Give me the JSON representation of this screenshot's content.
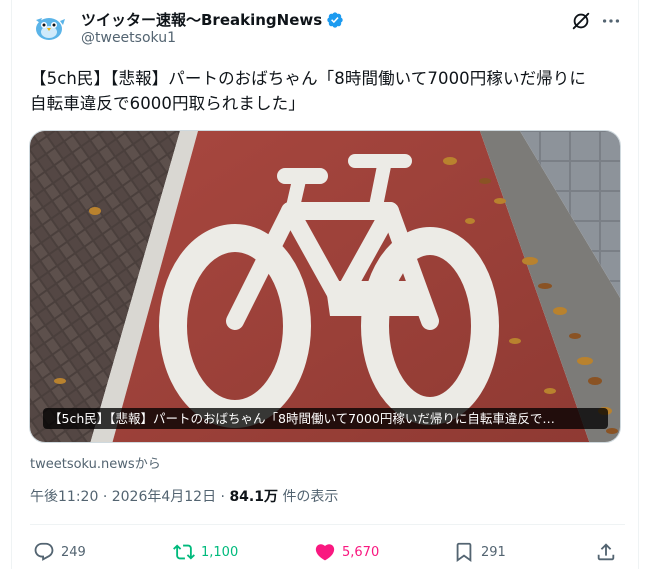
{
  "author": {
    "display_name": "ツイッター速報〜BreakingNews",
    "handle": "@tweetsoku1",
    "verified": true
  },
  "tweet": {
    "text_line1": "【5ch民】【悲報】パートのおばちゃん「8時間働いて7000円稼いだ帰りに",
    "text_line2": "自転車違反で6000円取られました」"
  },
  "media": {
    "caption": "【5ch民】【悲報】パートのおばちゃん「8時間働いて7000円稼いだ帰りに自転車違反で…"
  },
  "source": {
    "label": "tweetsoku.newsから"
  },
  "meta": {
    "time": "午後11:20",
    "separator": "·",
    "date": "2026年4月12日",
    "views_count": "84.1万",
    "views_label": "件の表示"
  },
  "actions": {
    "replies": "249",
    "retweets": "1,100",
    "likes": "5,670",
    "bookmarks": "291"
  },
  "colors": {
    "text_primary": "#0f1419",
    "text_secondary": "#536471",
    "verified": "#1d9bf0",
    "retweet_active": "#00ba7c",
    "like_active": "#f91880"
  },
  "icons": {
    "verified": "verified-badge-icon",
    "grok": "grok-icon",
    "more": "more-dots-icon",
    "reply": "reply-icon",
    "retweet": "retweet-icon",
    "like": "heart-icon",
    "bookmark": "bookmark-icon",
    "share": "share-icon"
  }
}
